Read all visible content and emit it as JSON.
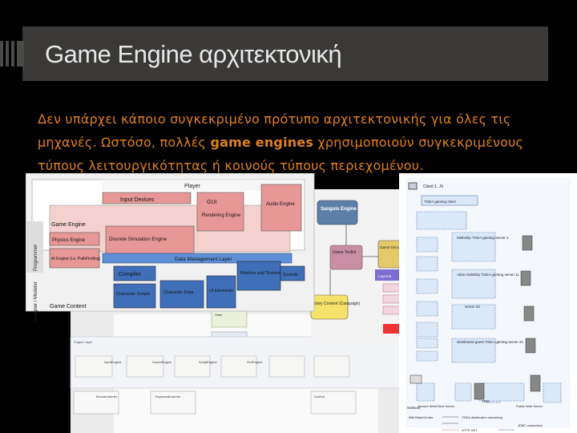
{
  "slide": {
    "title": "Game Engine αρχιτεκτονική",
    "body_part1": "Δεν υπάρχει κάποιο συγκεκριμένο πρότυπο αρχιτεκτονικής για όλες τις μηχανές. Ωστόσο, πολλές ",
    "body_bold": "game engines",
    "body_part2": " χρησιμοποιούν συγκεκριμένους τύπους λειτουργικότητας ή κοινούς τύπους περιεχομένου."
  },
  "diagram_front": {
    "player": "Player",
    "input_devices": "Input Devices",
    "gui": "GUI",
    "rendering_engine": "Rendering Engine",
    "audio_engine": "Audio Engine",
    "game_engine": "Game Engine",
    "physics_engine": "Physics Engine",
    "discrete_sim": "Discrete Simulation Engine",
    "ai_engine": "AI Engine (i.e. PathFinding)",
    "data_mgmt": "Data Management Layer",
    "programmer": "Programmer",
    "compiler": "Compiler",
    "meshes": "Meshes and Textures",
    "sounds": "Sounds",
    "character_scripts": "Character Scripts",
    "character_data": "Character Data",
    "ui_elements": "UI Elements",
    "game_content": "Game Content",
    "designer_modeler": "Designer / Modeler"
  },
  "diagram_middle": {
    "sanguis_engine": "Sanguis Engine",
    "game_toolkit": "Game Toolkit",
    "game_document_builder": "Game Document Builder",
    "story_content": "Story Content (Campaign)",
    "layered": "Layered"
  },
  "diagram_right": {
    "client": "Client 1...N",
    "tgea_client": "TGEA gaming client",
    "server_2": "Multiship TGEA gaming server 2",
    "server_11": "Atlas multiship TGEA gaming server 11",
    "server_20": "server 20",
    "server_distributed": "Distributed guest TGEA gaming server 21",
    "dbs": "DBs",
    "secure_web": "Secure WebClient Server",
    "web_server": "Public Web Server",
    "network": "Network",
    "blade_center": "IBM BladeCenter",
    "networking": "TGEA distributed networking",
    "http": "HTTP GET",
    "jdbc": "JDBC connection"
  },
  "diagram_back": {
    "engine_layer": "Engine Layer",
    "input_engine": "InputEngine",
    "sound_engine": "SoundEngine",
    "script_engine": "ScriptEngine",
    "gui_engine": "GUIEngine",
    "mouse_listener": "MouseListener",
    "keyboard_listener": "KeyboardListener",
    "control": "Control",
    "state": "State",
    "camera": "Camera"
  },
  "colors": {
    "title_text": "#e8e8e8",
    "body_text": "#e0801c",
    "pink_box": "#e79896",
    "blue_box": "#3f6fb8"
  }
}
